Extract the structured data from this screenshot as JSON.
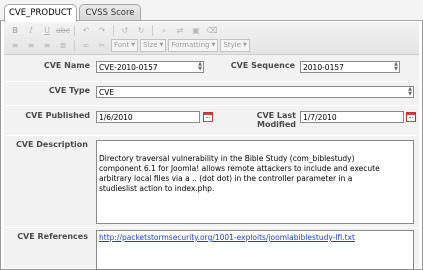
{
  "tabs": [
    {
      "label": "CVE_PRODUCT",
      "active": true
    },
    {
      "label": "CVSS Score",
      "active": false
    }
  ],
  "toolbar": {
    "font_label": "Font",
    "size_label": "Size",
    "formatting_label": "Formatting",
    "style_label": "Style"
  },
  "fields": {
    "cve_name": {
      "label": "CVE Name",
      "value": "CVE-2010-0157"
    },
    "cve_sequence": {
      "label": "CVE Sequence",
      "value": "2010-0157"
    },
    "cve_type": {
      "label": "CVE Type",
      "value": "CVE"
    },
    "cve_published": {
      "label": "CVE Published",
      "value": "1/6/2010"
    },
    "cve_last_modified": {
      "label": "CVE Last Modified",
      "value": "1/7/2010"
    },
    "cve_description": {
      "label": "CVE Description",
      "value": "Directory traversal vulnerability in the Bible Study (com_biblestudy) component 6.1 for Joomla! allows remote attackers to include and execute arbitrary local files via a .. (dot dot) in the controller parameter in a studieslist action to index.php."
    },
    "cve_references": {
      "label": "CVE References",
      "value": "http://packetstormsecurity.org/1001-exploits/joomlabiblestudy-lfi.txt"
    }
  },
  "colors": {
    "form_background": "#f2f2f2",
    "link": "#1a3fd1",
    "calendar_icon": "#b33333"
  }
}
